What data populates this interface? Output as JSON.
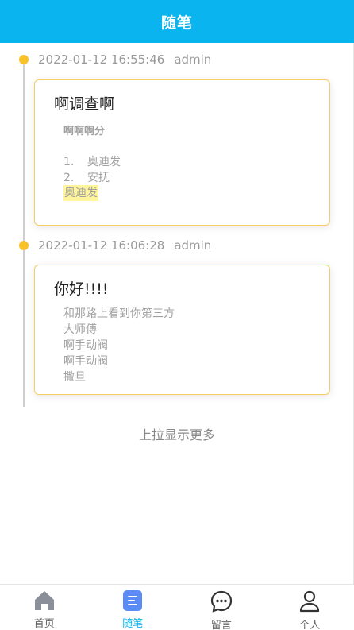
{
  "header": {
    "title": "随笔"
  },
  "entries": [
    {
      "date": "2022-01-12 16:55:46",
      "author": "admin",
      "title": "啊调查啊",
      "subtitle": "啊啊啊分",
      "list": [
        {
          "num": "1.",
          "text": "奥迪发"
        },
        {
          "num": "2.",
          "text": "安抚"
        }
      ],
      "highlight": "奥迪发"
    },
    {
      "date": "2022-01-12 16:06:28",
      "author": "admin",
      "title": "你好!!!!",
      "lines": [
        "和那路上看到你第三方",
        "大师傅",
        "啊手动阀",
        "啊手动阀",
        "撒旦"
      ]
    }
  ],
  "load_more": "上拉显示更多",
  "tabbar": {
    "items": [
      {
        "label": "首页",
        "icon": "home-icon"
      },
      {
        "label": "随笔",
        "icon": "notes-icon",
        "active": true
      },
      {
        "label": "留言",
        "icon": "message-icon"
      },
      {
        "label": "个人",
        "icon": "user-icon"
      }
    ]
  },
  "colors": {
    "header": "#0ab4ef",
    "dot": "#f8c12a",
    "card_border": "#f3cf63",
    "highlight": "#fff59d",
    "active_tab": "#0ab4ef",
    "active_icon": "#5b8cf5"
  }
}
